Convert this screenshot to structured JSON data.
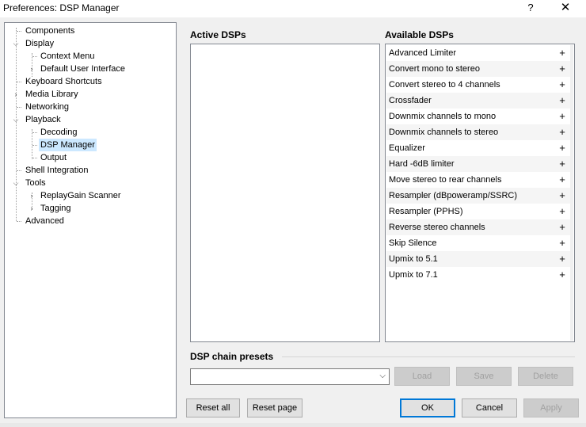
{
  "window": {
    "title": "Preferences: DSP Manager",
    "help_glyph": "?",
    "close_glyph": "✕"
  },
  "tree": [
    {
      "label": "Components"
    },
    {
      "label": "Display"
    },
    {
      "label": "Context Menu"
    },
    {
      "label": "Default User Interface"
    },
    {
      "label": "Keyboard Shortcuts"
    },
    {
      "label": "Media Library"
    },
    {
      "label": "Networking"
    },
    {
      "label": "Playback"
    },
    {
      "label": "Decoding"
    },
    {
      "label": "DSP Manager"
    },
    {
      "label": "Output"
    },
    {
      "label": "Shell Integration"
    },
    {
      "label": "Tools"
    },
    {
      "label": "ReplayGain Scanner"
    },
    {
      "label": "Tagging"
    },
    {
      "label": "Advanced"
    }
  ],
  "selected_tree_item": "DSP Manager",
  "active_dsps": {
    "title": "Active DSPs",
    "items": []
  },
  "available_dsps": {
    "title": "Available DSPs",
    "add_glyph": "+",
    "items": [
      "Advanced Limiter",
      "Convert mono to stereo",
      "Convert stereo to 4 channels",
      "Crossfader",
      "Downmix channels to mono",
      "Downmix channels to stereo",
      "Equalizer",
      "Hard -6dB limiter",
      "Move stereo to rear channels",
      "Resampler (dBpoweramp/SSRC)",
      "Resampler (PPHS)",
      "Reverse stereo channels",
      "Skip Silence",
      "Upmix to 5.1",
      "Upmix to 7.1"
    ]
  },
  "presets": {
    "title": "DSP chain presets",
    "combo_value": "",
    "load": "Load",
    "save": "Save",
    "delete": "Delete"
  },
  "buttons": {
    "reset_all": "Reset all",
    "reset_page": "Reset page",
    "ok": "OK",
    "cancel": "Cancel",
    "apply": "Apply"
  }
}
